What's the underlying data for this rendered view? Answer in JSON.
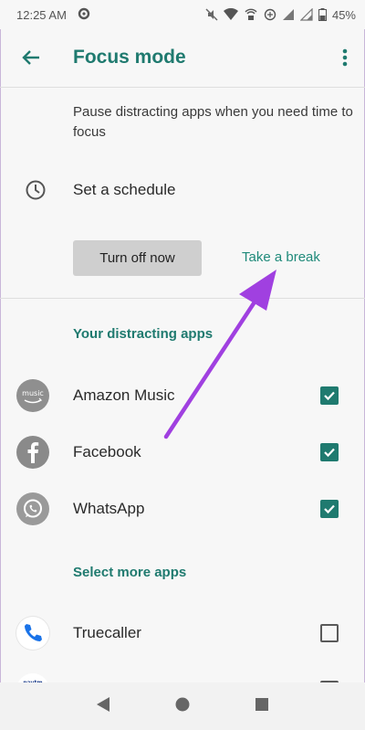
{
  "status_bar": {
    "time": "12:25 AM",
    "battery": "45%"
  },
  "app_bar": {
    "title": "Focus mode"
  },
  "description": "Pause distracting apps when you need time to focus",
  "schedule": {
    "label": "Set a schedule"
  },
  "actions": {
    "turn_off_label": "Turn off now",
    "break_label": "Take a break"
  },
  "distracting": {
    "header": "Your distracting apps",
    "apps": [
      {
        "name": "Amazon Music",
        "checked": true,
        "icon": "amazon-music-icon"
      },
      {
        "name": "Facebook",
        "checked": true,
        "icon": "facebook-icon"
      },
      {
        "name": "WhatsApp",
        "checked": true,
        "icon": "whatsapp-icon"
      }
    ]
  },
  "more": {
    "header": "Select more apps",
    "apps": [
      {
        "name": "Truecaller",
        "checked": false,
        "icon": "truecaller-icon"
      }
    ]
  },
  "icon_labels": {
    "amazon_music": "music",
    "paytm": "paytm"
  },
  "colors": {
    "accent": "#1f7a6f",
    "arrow": "#a040e0"
  }
}
